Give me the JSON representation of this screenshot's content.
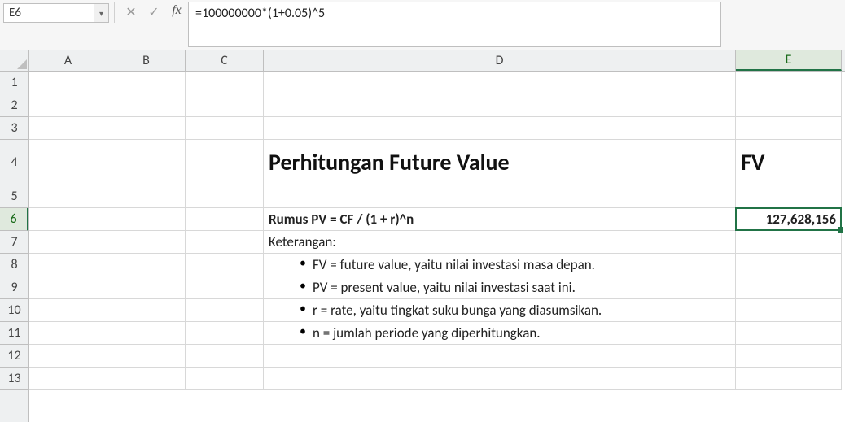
{
  "namebox": {
    "value": "E6"
  },
  "formula_bar": {
    "cancel_icon": "✕",
    "enter_icon": "✓",
    "fx_label": "fx",
    "formula": "=100000000*(1+0.05)^5"
  },
  "columns": [
    "A",
    "B",
    "C",
    "D",
    "E"
  ],
  "rows": [
    "1",
    "2",
    "3",
    "4",
    "5",
    "6",
    "7",
    "8",
    "9",
    "10",
    "11",
    "12",
    "13"
  ],
  "active_column": "E",
  "active_row": "6",
  "cells": {
    "D4": "Perhitungan Future Value",
    "E4": "FV",
    "D6": "Rumus PV = CF / (1 + r)^n",
    "E6": "127,628,156",
    "D7": "Keterangan:",
    "D8": "FV = future value, yaitu nilai investasi masa depan.",
    "D9": "PV = present value, yaitu nilai investasi saat ini.",
    "D10": "r = rate, yaitu tingkat suku bunga yang diasumsikan.",
    "D11": "n = jumlah periode yang diperhitungkan."
  },
  "chart_data": {
    "type": "table",
    "title": "Perhitungan Future Value",
    "formula_cell": "E6",
    "formula": "=100000000*(1+0.05)^5",
    "result_label": "FV",
    "result_value": 127628156,
    "pv_formula_text": "Rumus PV = CF / (1 + r)^n",
    "legend": [
      "FV = future value, yaitu nilai investasi masa depan.",
      "PV = present value, yaitu nilai investasi saat ini.",
      "r = rate, yaitu tingkat suku bunga yang diasumsikan.",
      "n = jumlah periode yang diperhitungkan."
    ]
  }
}
